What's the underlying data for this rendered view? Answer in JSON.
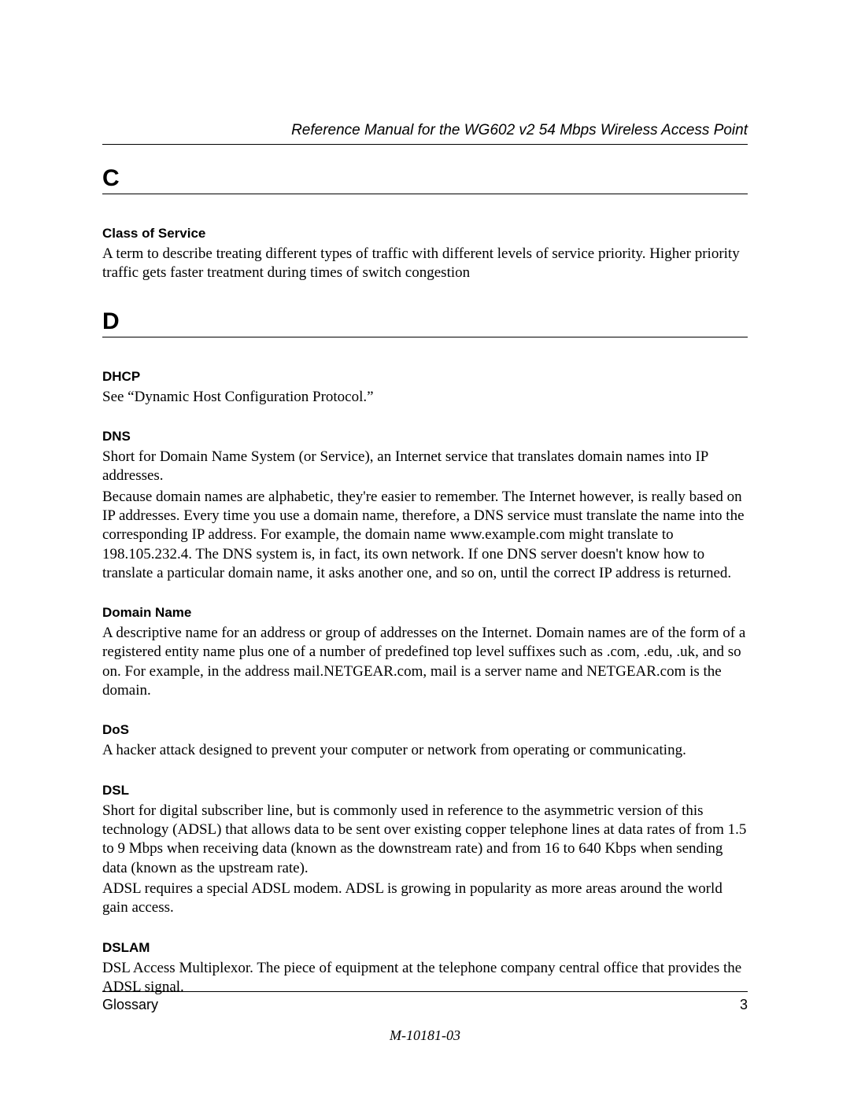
{
  "header": {
    "title": "Reference Manual for the WG602 v2 54 Mbps Wireless Access Point"
  },
  "sections": {
    "C": {
      "letter": "C",
      "entries": {
        "class_of_service": {
          "term": "Class of Service",
          "definition": "A term to describe treating different types of traffic with different levels of service priority.  Higher priority traffic gets faster treatment during times of switch congestion"
        }
      }
    },
    "D": {
      "letter": "D",
      "entries": {
        "dhcp": {
          "term": "DHCP",
          "definition": "See “Dynamic Host Configuration Protocol.”"
        },
        "dns": {
          "term": "DNS",
          "definition_p1": "Short for Domain Name System (or Service), an Internet service that translates domain names into IP addresses.",
          "definition_p2": "Because domain names are alphabetic, they're easier to remember. The Internet however, is really based on IP addresses. Every time you use a domain name, therefore, a DNS service must translate the name into the corresponding IP address. For example, the domain name www.example.com might translate to 198.105.232.4. The DNS system is, in fact, its own network. If one DNS server doesn't know how to translate a particular domain name, it asks another one, and so on, until the correct IP address is returned."
        },
        "domain_name": {
          "term": "Domain Name",
          "definition": "A descriptive name for an address or group of addresses on the Internet. Domain names are of the form of a registered entity name plus one of a number of predefined top level suffixes such as .com, .edu, .uk, and so on. For example, in the address mail.NETGEAR.com, mail is a server name and NETGEAR.com is the domain."
        },
        "dos": {
          "term": "DoS",
          "definition": "A hacker attack designed to prevent your computer or network from operating or communicating."
        },
        "dsl": {
          "term": "DSL",
          "definition_p1": "Short for digital subscriber line, but is commonly used in reference to the asymmetric version of this technology (ADSL) that allows data to be sent over existing copper telephone lines at data rates of from 1.5 to 9 Mbps when receiving data (known as the downstream rate) and from 16 to 640 Kbps when sending data (known as the upstream rate).",
          "definition_p2": "ADSL requires a special ADSL modem. ADSL is growing in popularity as more areas around the world gain access."
        },
        "dslam": {
          "term": "DSLAM",
          "definition": "DSL Access Multiplexor. The piece of equipment at the telephone company central office that provides the ADSL signal."
        }
      }
    }
  },
  "footer": {
    "section_name": "Glossary",
    "page_number": "3",
    "doc_number": "M-10181-03"
  }
}
